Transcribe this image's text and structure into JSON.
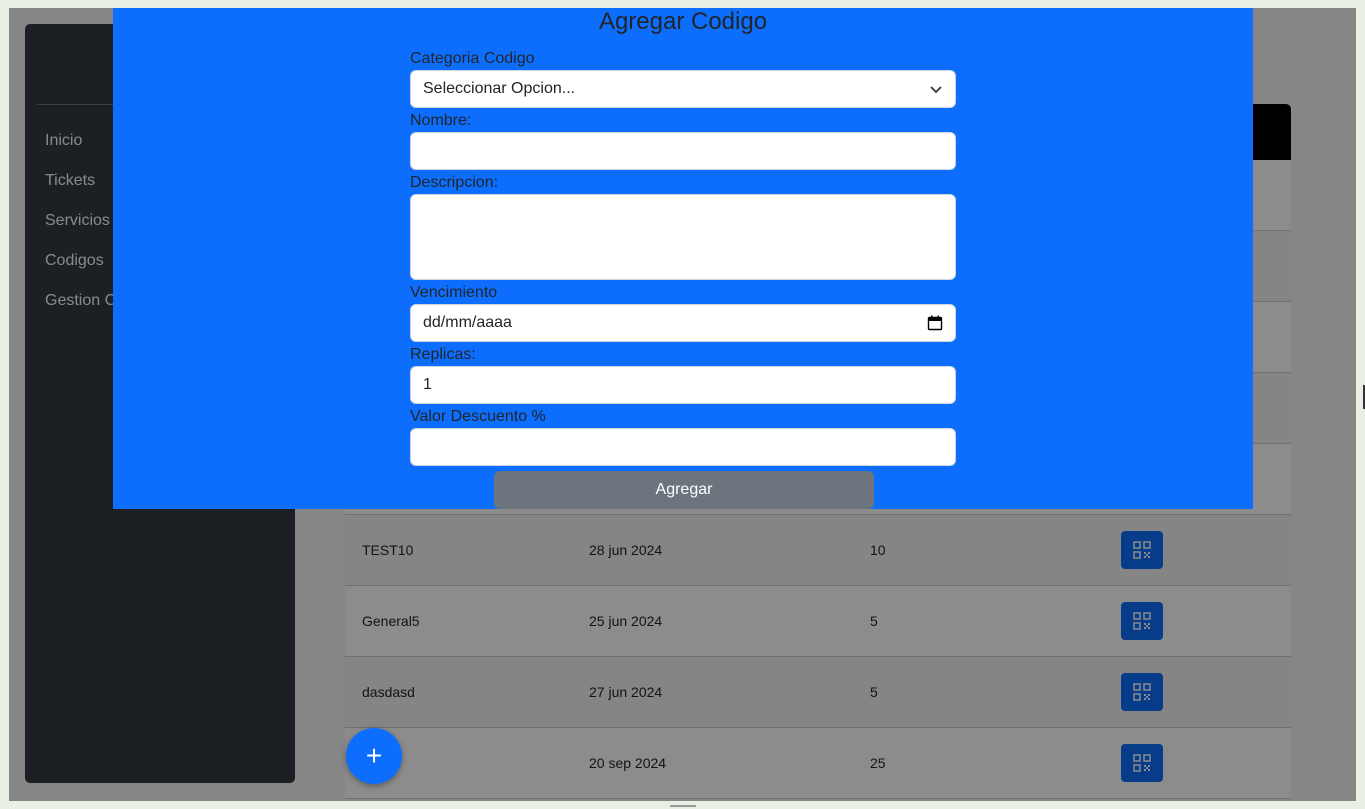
{
  "sidebar": {
    "items": [
      "Inicio",
      "Tickets",
      "Servicios",
      "Codigos",
      "Gestion C"
    ]
  },
  "table": {
    "rows": [
      {
        "code": "TEST10",
        "date": "28 jun 2024",
        "value": "10"
      },
      {
        "code": "General5",
        "date": "25 jun 2024",
        "value": "5"
      },
      {
        "code": "dasdasd",
        "date": "27 jun 2024",
        "value": "5"
      },
      {
        "code": "",
        "date": "20 sep 2024",
        "value": "25"
      }
    ]
  },
  "fab": {
    "label": "+"
  },
  "modal": {
    "title": "Agregar Codigo",
    "category_label": "Categoria Codigo",
    "category_value": "Seleccionar Opcion...",
    "name_label": "Nombre:",
    "name_value": "",
    "description_label": "Descripcion:",
    "description_value": "",
    "expiry_label": "Vencimiento",
    "expiry_placeholder": "dd/mm/aaaa",
    "replicas_label": "Replicas:",
    "replicas_value": "1",
    "discount_label": "Valor Descuento %",
    "discount_value": "",
    "submit_label": "Agregar"
  },
  "colors": {
    "primary": "#0d6efd",
    "sidebar": "#343a40",
    "secondary": "#6c757d"
  }
}
